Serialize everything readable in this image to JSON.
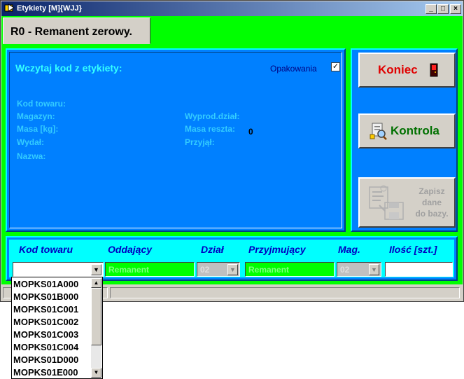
{
  "window": {
    "title": "Etykiety [M]{WJJ}"
  },
  "tab": {
    "label": "R0 - Remanent zerowy."
  },
  "main": {
    "heading": "Wczytaj kod z etykiety:",
    "opakowania_label": "Opakowania",
    "opakowania_checked": "✓",
    "fields_left": [
      "Kod towaru:",
      "Magazyn:",
      "Masa [kg]:",
      "Wydał:",
      "Nazwa:"
    ],
    "fields_right": [
      "Wyprod.dział:",
      "Masa reszta:",
      "Przyjął:"
    ],
    "masa_reszta_value": "0"
  },
  "buttons": {
    "koniec": "Koniec",
    "kontrola": "Kontrola",
    "zapisz_line1": "Zapisz",
    "zapisz_line2": "dane",
    "zapisz_line3": "do bazy."
  },
  "bottom": {
    "headers": [
      "Kod towaru",
      "Oddający",
      "Dział",
      "Przyjmujący",
      "Mag.",
      "Ilość [szt.]"
    ],
    "kod_towaru_value": "",
    "oddajacy_value": "Remanent",
    "dzial_value": "02",
    "przyjmujacy_value": "Remanent",
    "mag_value": "02",
    "ilosc_value": ""
  },
  "dropdown": {
    "items": [
      "MOPKS01A000",
      "MOPKS01B000",
      "MOPKS01C001",
      "MOPKS01C002",
      "MOPKS01C003",
      "MOPKS01C004",
      "MOPKS01D000",
      "MOPKS01E000"
    ]
  }
}
